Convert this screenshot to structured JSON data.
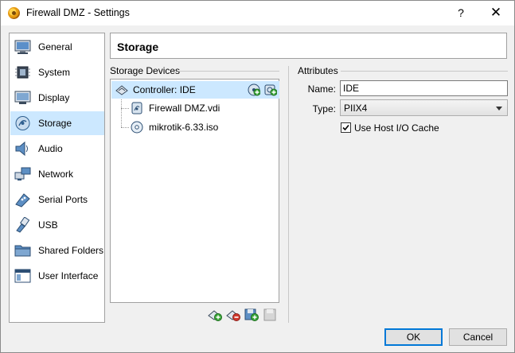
{
  "window": {
    "title": "Firewall DMZ - Settings",
    "help_label": "?",
    "close_label": "✕"
  },
  "nav": {
    "items": [
      {
        "label": "General",
        "icon": "monitor-general-icon"
      },
      {
        "label": "System",
        "icon": "chip-icon"
      },
      {
        "label": "Display",
        "icon": "display-icon"
      },
      {
        "label": "Storage",
        "icon": "disk-icon",
        "selected": true
      },
      {
        "label": "Audio",
        "icon": "speaker-icon"
      },
      {
        "label": "Network",
        "icon": "network-icon"
      },
      {
        "label": "Serial Ports",
        "icon": "serial-port-icon"
      },
      {
        "label": "USB",
        "icon": "usb-icon"
      },
      {
        "label": "Shared Folders",
        "icon": "folder-icon"
      },
      {
        "label": "User Interface",
        "icon": "window-icon"
      }
    ]
  },
  "page": {
    "title": "Storage"
  },
  "storage_devices": {
    "label": "Storage Devices",
    "controller": "Controller: IDE",
    "attachments": [
      {
        "label": "Firewall DMZ.vdi",
        "icon": "hard-disk-icon"
      },
      {
        "label": "mikrotik-6.33.iso",
        "icon": "optical-disc-icon"
      }
    ]
  },
  "attributes": {
    "label": "Attributes",
    "name_label": "Name:",
    "name_value": "IDE",
    "type_label": "Type:",
    "type_value": "PIIX4",
    "host_io_cache_label": "Use Host I/O Cache",
    "host_io_cache_checked": true
  },
  "buttons": {
    "ok": "OK",
    "cancel": "Cancel"
  }
}
